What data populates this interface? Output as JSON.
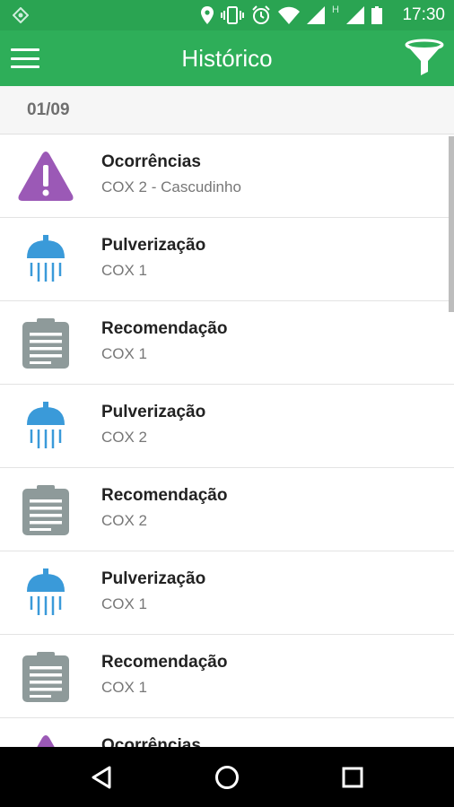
{
  "status_bar": {
    "time": "17:30",
    "network_label": "H",
    "icons": [
      "app-notification-icon",
      "location-icon",
      "vibrate-icon",
      "alarm-icon",
      "wifi-icon",
      "signal-icon",
      "signal-icon",
      "battery-icon"
    ]
  },
  "app_bar": {
    "title": "Histórico",
    "menu_icon": "menu-icon",
    "filter_icon": "filter-icon"
  },
  "history": {
    "date": "01/09",
    "items": [
      {
        "type": "warning-icon",
        "title": "Ocorrências",
        "subtitle": "COX 2 - Cascudinho"
      },
      {
        "type": "shower-icon",
        "title": "Pulverização",
        "subtitle": "COX 1"
      },
      {
        "type": "clipboard-icon",
        "title": "Recomendação",
        "subtitle": "COX 1"
      },
      {
        "type": "shower-icon",
        "title": "Pulverização",
        "subtitle": "COX 2"
      },
      {
        "type": "clipboard-icon",
        "title": "Recomendação",
        "subtitle": "COX 2"
      },
      {
        "type": "shower-icon",
        "title": "Pulverização",
        "subtitle": "COX 1"
      },
      {
        "type": "clipboard-icon",
        "title": "Recomendação",
        "subtitle": "COX 1"
      },
      {
        "type": "warning-icon",
        "title": "Ocorrências",
        "subtitle": ""
      }
    ]
  },
  "colors": {
    "status_bar": "#2aa452",
    "app_bar": "#2eae59",
    "warning": "#9b59b6",
    "shower": "#3a9ad9",
    "clipboard": "#8e9a9a"
  },
  "nav_bar": {
    "icons": [
      "back-icon",
      "home-icon",
      "recents-icon"
    ]
  }
}
